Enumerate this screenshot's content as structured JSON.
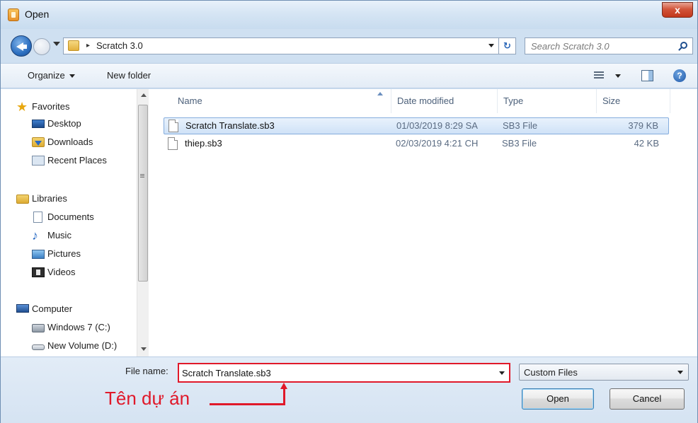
{
  "window": {
    "title": "Open",
    "close_label": "x"
  },
  "address": {
    "breadcrumb": "Scratch 3.0",
    "crumb_arrow": "▸",
    "refresh_glyph": "↻"
  },
  "search": {
    "placeholder": "Search Scratch 3.0"
  },
  "toolbar": {
    "organize_label": "Organize",
    "new_folder_label": "New folder",
    "help_glyph": "?"
  },
  "nav": {
    "favorites": {
      "label": "Favorites",
      "items": [
        "Desktop",
        "Downloads",
        "Recent Places"
      ]
    },
    "libraries": {
      "label": "Libraries",
      "items": [
        "Documents",
        "Music",
        "Pictures",
        "Videos"
      ]
    },
    "computer": {
      "label": "Computer",
      "items": [
        "Windows 7 (C:)",
        "New Volume (D:)"
      ]
    }
  },
  "columns": [
    "Name",
    "Date modified",
    "Type",
    "Size"
  ],
  "files": [
    {
      "name": "Scratch Translate.sb3",
      "date": "01/03/2019 8:29 SA",
      "type": "SB3 File",
      "size": "379 KB",
      "selected": true
    },
    {
      "name": "thiep.sb3",
      "date": "02/03/2019 4:21 CH",
      "type": "SB3 File",
      "size": "42 KB",
      "selected": false
    }
  ],
  "bottom": {
    "file_name_label": "File name:",
    "file_name_value": "Scratch Translate.sb3",
    "filter_value": "Custom Files",
    "open_label": "Open",
    "cancel_label": "Cancel"
  },
  "annotation": {
    "text": "Tên dự án",
    "color": "#e0192a"
  }
}
